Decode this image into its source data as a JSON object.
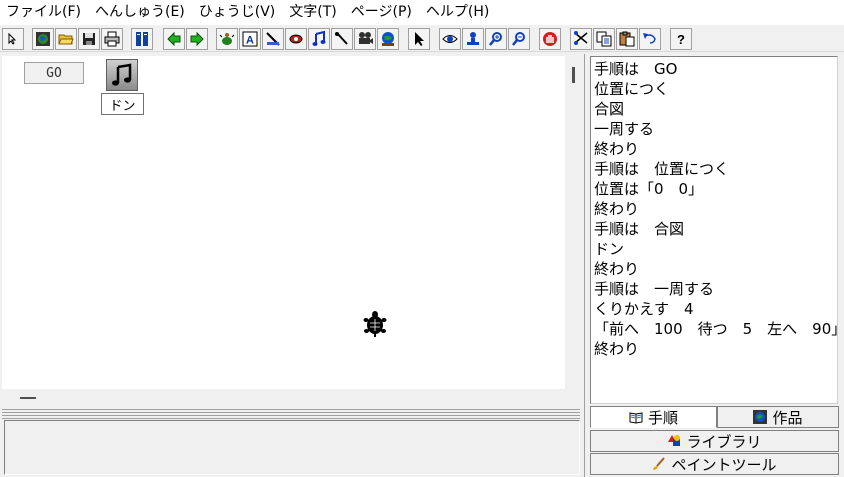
{
  "menu": [
    "ファイル(F)",
    "へんしゅう(E)",
    "ひょうじ(V)",
    "文字(T)",
    "ページ(P)",
    "ヘルプ(H)"
  ],
  "canvas": {
    "go_button": "GO",
    "sound_label": "ドン"
  },
  "script_lines": [
    "手順は　GO",
    "位置につく",
    "合図",
    "一周する",
    "終わり",
    "手順は　位置につく",
    "位置は「0　0」",
    "終わり",
    "手順は　合図",
    "ドン",
    "終わり",
    "手順は　一周する",
    "くりかえす　4",
    "「前へ　100　待つ　5　左へ　90」",
    "終わり"
  ],
  "tabs": {
    "procedures": "手順",
    "works": "作品",
    "library": "ライブラリ",
    "paint_tool": "ペイントツール"
  },
  "toolbar": {
    "help": "?"
  },
  "toolbar_icons": [
    "pointer-small-icon",
    "globe-icon",
    "open-folder-icon",
    "save-icon",
    "print-icon",
    "pages-icon",
    "back-arrow-icon",
    "forward-arrow-icon",
    "new-turtle-icon",
    "text-box-icon",
    "slider-tool-icon",
    "shape-tool-icon",
    "music-note-icon",
    "pen-tool-icon",
    "camera-icon",
    "globe-stamp-icon",
    "select-arrow-icon",
    "eye-icon",
    "stamp-icon",
    "zoom-in-icon",
    "zoom-out-icon",
    "stop-hand-icon",
    "cut-icon",
    "copy-icon",
    "paste-icon",
    "undo-icon",
    "help-icon"
  ]
}
